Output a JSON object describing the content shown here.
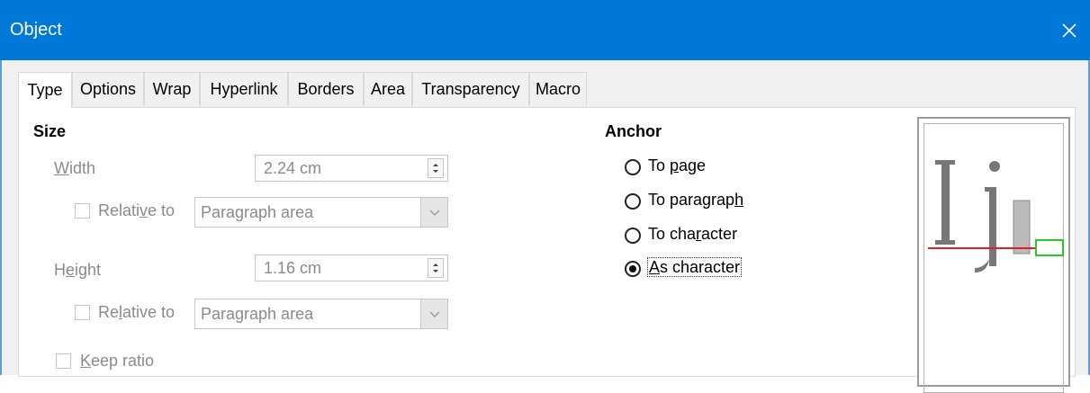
{
  "window": {
    "title": "Object"
  },
  "tabs": [
    {
      "label": "Type",
      "active": true
    },
    {
      "label": "Options"
    },
    {
      "label": "Wrap"
    },
    {
      "label": "Hyperlink"
    },
    {
      "label": "Borders"
    },
    {
      "label": "Area"
    },
    {
      "label": "Transparency"
    },
    {
      "label": "Macro"
    }
  ],
  "size": {
    "heading": "Size",
    "width": {
      "label_first": "W",
      "label_rest": "idth",
      "value": "2.24 cm",
      "relative_pre": "Relati",
      "relative_ul": "v",
      "relative_post": "e to",
      "relative_value": "Paragraph area"
    },
    "height": {
      "label_pre": "H",
      "label_ul": "e",
      "label_post": "ight",
      "value": "1.16 cm",
      "relative_pre": "Re",
      "relative_ul": "l",
      "relative_post": "ative to",
      "relative_value": "Paragraph area"
    },
    "keep_ratio_first": "K",
    "keep_ratio_rest": "eep ratio"
  },
  "anchor": {
    "heading": "Anchor",
    "options": [
      {
        "pre": "To ",
        "ul": "p",
        "post": "age",
        "checked": false
      },
      {
        "pre": "To paragrap",
        "ul": "h",
        "post": "",
        "checked": false
      },
      {
        "pre": "To cha",
        "ul": "r",
        "post": "acter",
        "checked": false
      },
      {
        "pre": "",
        "ul": "A",
        "post": "s character",
        "checked": true
      }
    ]
  },
  "colors": {
    "titlebar": "#0078d7",
    "baseline": "#e02020",
    "anchor_box": "#22cc22"
  }
}
